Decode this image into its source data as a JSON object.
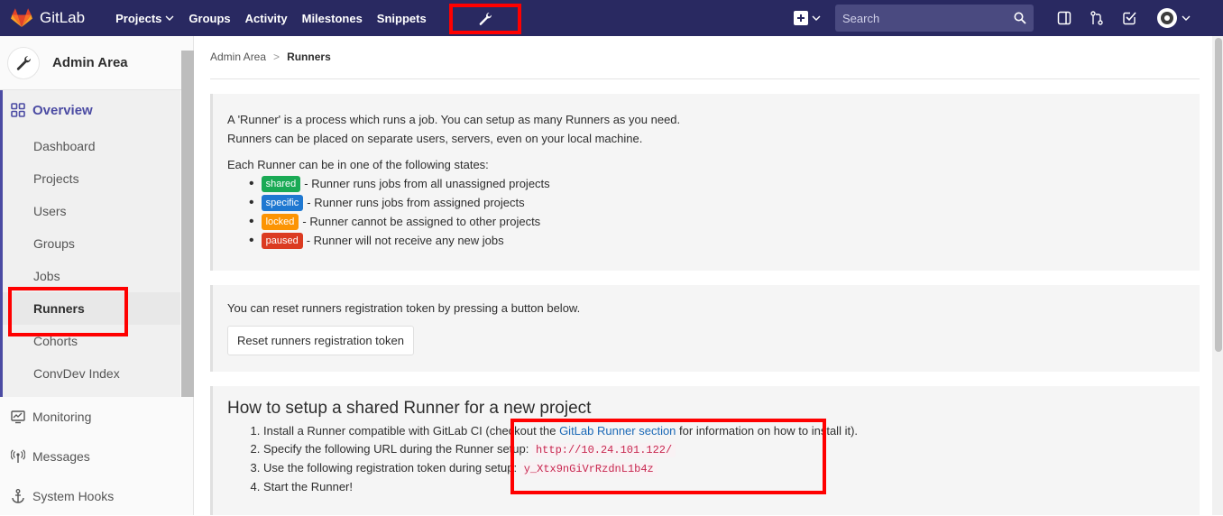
{
  "navbar": {
    "logo_text": "GitLab",
    "links": [
      {
        "label": "Projects",
        "dropdown": true
      },
      {
        "label": "Groups"
      },
      {
        "label": "Activity"
      },
      {
        "label": "Milestones"
      },
      {
        "label": "Snippets"
      }
    ],
    "admin_icon": "wrench-icon",
    "search_placeholder": "Search",
    "background": "#292961"
  },
  "sidebar": {
    "title": "Admin Area",
    "overview_label": "Overview",
    "overview_items": [
      {
        "label": "Dashboard",
        "active": false
      },
      {
        "label": "Projects",
        "active": false
      },
      {
        "label": "Users",
        "active": false
      },
      {
        "label": "Groups",
        "active": false
      },
      {
        "label": "Jobs",
        "active": false
      },
      {
        "label": "Runners",
        "active": true
      },
      {
        "label": "Cohorts",
        "active": false
      },
      {
        "label": "ConvDev Index",
        "active": false
      }
    ],
    "other_items": [
      {
        "label": "Monitoring",
        "icon": "monitor-icon"
      },
      {
        "label": "Messages",
        "icon": "broadcast-icon"
      },
      {
        "label": "System Hooks",
        "icon": "anchor-icon"
      }
    ]
  },
  "breadcrumb": {
    "parent": "Admin Area",
    "separator": ">",
    "current": "Runners"
  },
  "info_panel": {
    "line1": "A 'Runner' is a process which runs a job. You can setup as many Runners as you need.",
    "line2": "Runners can be placed on separate users, servers, even on your local machine.",
    "states_intro": "Each Runner can be in one of the following states:",
    "states": [
      {
        "badge": "shared",
        "color": "#1aaa55",
        "text": " - Runner runs jobs from all unassigned projects"
      },
      {
        "badge": "specific",
        "color": "#1f78d1",
        "text": " - Runner runs jobs from assigned projects"
      },
      {
        "badge": "locked",
        "color": "#fc9403",
        "text": " - Runner cannot be assigned to other projects"
      },
      {
        "badge": "paused",
        "color": "#db3b21",
        "text": " - Runner will not receive any new jobs"
      }
    ]
  },
  "reset_panel": {
    "text": "You can reset runners registration token by pressing a button below.",
    "button": "Reset runners registration token"
  },
  "setup_panel": {
    "title": "How to setup a shared Runner for a new project",
    "step1_pre": "Install a Runner compatible with GitLab CI (checkout the ",
    "step1_link": "GitLab Runner section",
    "step1_post": " for information on how to install it).",
    "step2_pre": "Specify the following URL during the Runner setup: ",
    "step2_url": "http://10.24.101.122/",
    "step3_pre": "Use the following registration token during setup: ",
    "step3_token": "y_Xtx9nGiVrRzdnL1b4z",
    "step4": "Start the Runner!"
  },
  "colors": {
    "highlight": "#ff0000",
    "accent": "#4b4ba3",
    "link": "#1b69b6"
  }
}
